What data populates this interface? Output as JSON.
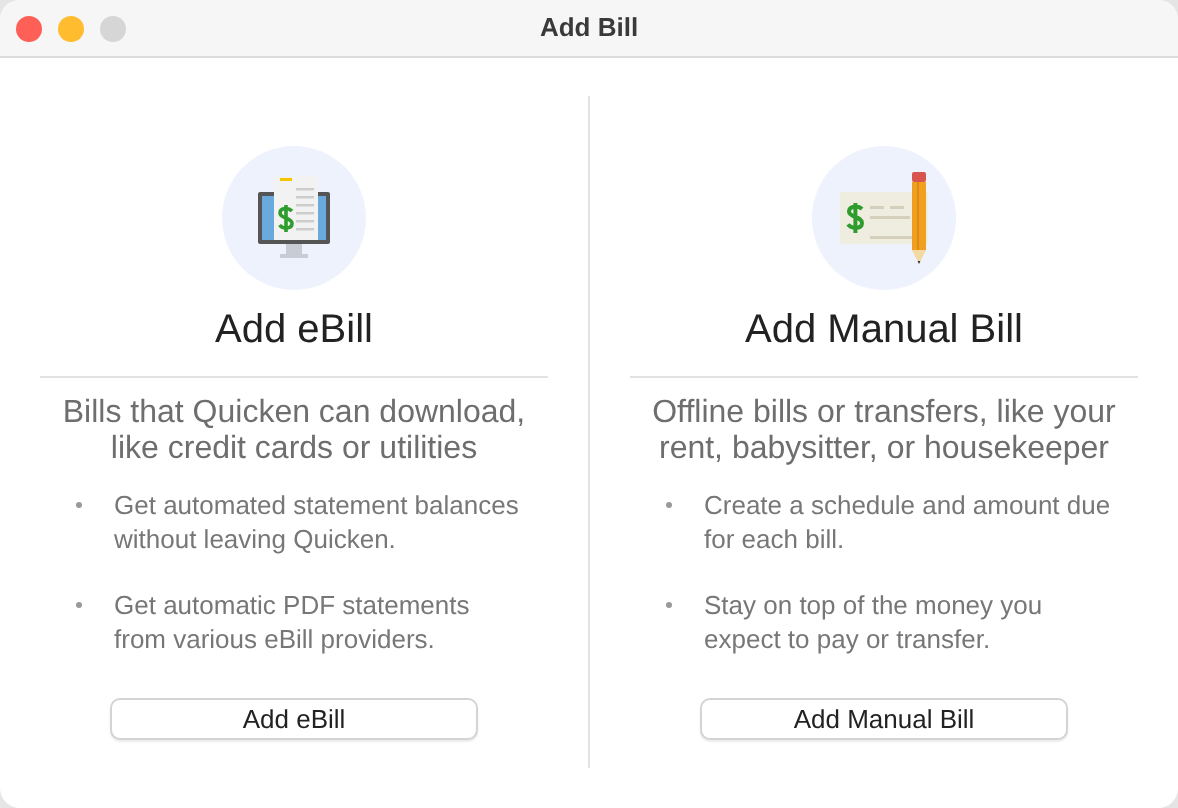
{
  "window": {
    "title": "Add Bill"
  },
  "panels": [
    {
      "kind": "ebill",
      "title": "Add eBill",
      "description": "Bills that Quicken can download, like credit cards or utilities",
      "bullets": [
        "Get automated statement balances without leaving Quicken.",
        "Get automatic PDF statements from various eBill providers."
      ],
      "button": "Add eBill"
    },
    {
      "kind": "manual",
      "title": "Add Manual Bill",
      "description": "Offline bills or transfers, like your rent, babysitter, or housekeeper",
      "bullets": [
        "Create a schedule and amount due for each bill.",
        "Stay on top of the money you expect to pay or transfer."
      ],
      "button": "Add Manual Bill"
    }
  ]
}
